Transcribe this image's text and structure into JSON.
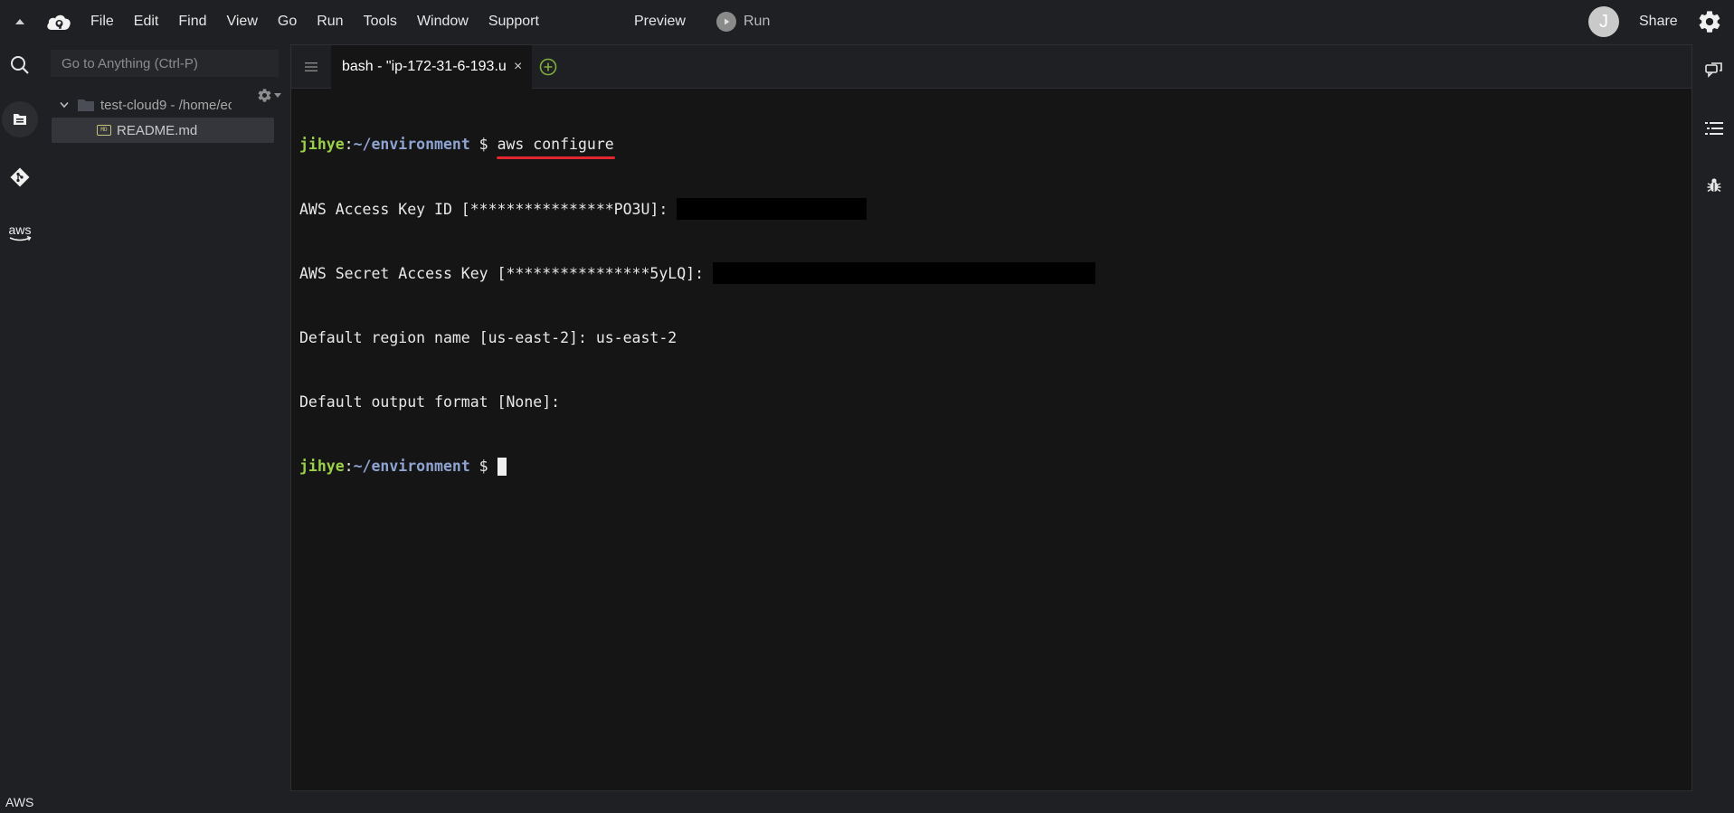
{
  "menubar": {
    "items": [
      "File",
      "Edit",
      "Find",
      "View",
      "Go",
      "Run",
      "Tools",
      "Window",
      "Support"
    ],
    "preview_label": "Preview",
    "run_label": "Run",
    "avatar_initial": "J",
    "share_label": "Share"
  },
  "left_rail": {
    "icons": [
      "search-icon",
      "files-icon",
      "git-icon",
      "aws-icon"
    ],
    "aws_logo_text": "aws",
    "footer_label": "AWS"
  },
  "file_panel": {
    "goto_placeholder": "Go to Anything (Ctrl-P)",
    "folder_label": "test-cloud9 - /home/ec",
    "file_label": "README.md",
    "file_icon_text": "MD"
  },
  "editor": {
    "tab_label": "bash - \"ip-172-31-6-193.u",
    "tab_close": "×"
  },
  "terminal": {
    "prompt_user": "jihye",
    "prompt_colon": ":",
    "prompt_path": "~/environment",
    "prompt_dollar": " $ ",
    "command": "aws configure",
    "line_access_key": "AWS Access Key ID [****************PO3U]: ",
    "line_secret_key": "AWS Secret Access Key [****************5yLQ]: ",
    "line_region": "Default region name [us-east-2]: us-east-2",
    "line_output": "Default output format [None]:"
  },
  "colors": {
    "background": "#1f2023",
    "terminal_bg": "#151515",
    "prompt_user": "#9bd14a",
    "prompt_path": "#8ea3d1",
    "underline_annotation": "#e3262f"
  }
}
